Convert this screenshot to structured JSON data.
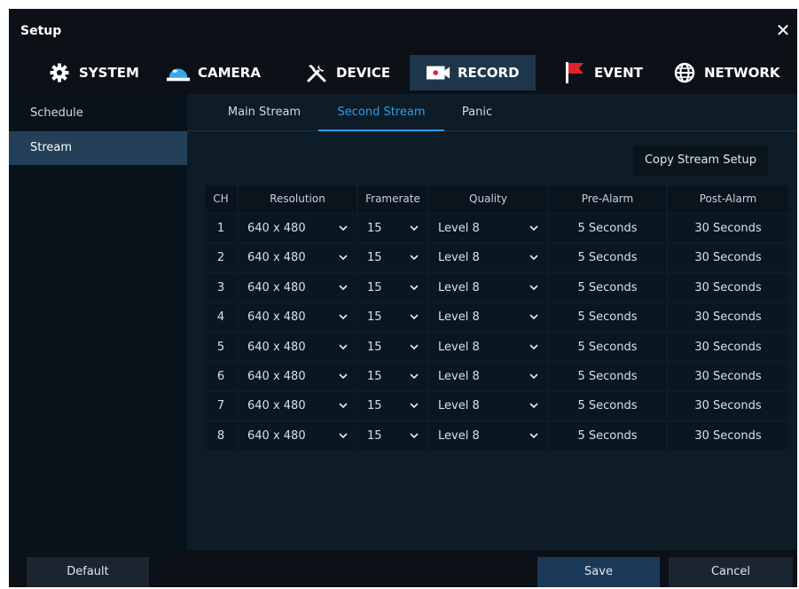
{
  "window": {
    "title": "Setup",
    "close_glyph": "✕"
  },
  "topnav": [
    {
      "label": "SYSTEM",
      "icon": "gear-icon"
    },
    {
      "label": "CAMERA",
      "icon": "dome-camera-icon"
    },
    {
      "label": "DEVICE",
      "icon": "tools-icon"
    },
    {
      "label": "RECORD",
      "icon": "record-icon",
      "active": true
    },
    {
      "label": "EVENT",
      "icon": "flag-icon"
    },
    {
      "label": "NETWORK",
      "icon": "globe-icon"
    }
  ],
  "sidebar": [
    {
      "label": "Schedule"
    },
    {
      "label": "Stream",
      "active": true
    }
  ],
  "subtabs": [
    {
      "label": "Main Stream"
    },
    {
      "label": "Second Stream",
      "active": true
    },
    {
      "label": "Panic"
    }
  ],
  "copy_button": "Copy Stream Setup",
  "table": {
    "headers": [
      "CH",
      "Resolution",
      "Framerate",
      "Quality",
      "Pre-Alarm",
      "Post-Alarm"
    ],
    "rows": [
      {
        "ch": "1",
        "resolution": "640 x 480",
        "framerate": "15",
        "quality": "Level 8",
        "pre": "5 Seconds",
        "post": "30 Seconds"
      },
      {
        "ch": "2",
        "resolution": "640 x 480",
        "framerate": "15",
        "quality": "Level 8",
        "pre": "5 Seconds",
        "post": "30 Seconds"
      },
      {
        "ch": "3",
        "resolution": "640 x 480",
        "framerate": "15",
        "quality": "Level 8",
        "pre": "5 Seconds",
        "post": "30 Seconds"
      },
      {
        "ch": "4",
        "resolution": "640 x 480",
        "framerate": "15",
        "quality": "Level 8",
        "pre": "5 Seconds",
        "post": "30 Seconds"
      },
      {
        "ch": "5",
        "resolution": "640 x 480",
        "framerate": "15",
        "quality": "Level 8",
        "pre": "5 Seconds",
        "post": "30 Seconds"
      },
      {
        "ch": "6",
        "resolution": "640 x 480",
        "framerate": "15",
        "quality": "Level 8",
        "pre": "5 Seconds",
        "post": "30 Seconds"
      },
      {
        "ch": "7",
        "resolution": "640 x 480",
        "framerate": "15",
        "quality": "Level 8",
        "pre": "5 Seconds",
        "post": "30 Seconds"
      },
      {
        "ch": "8",
        "resolution": "640 x 480",
        "framerate": "15",
        "quality": "Level 8",
        "pre": "5 Seconds",
        "post": "30 Seconds"
      }
    ]
  },
  "footer": {
    "default": "Default",
    "save": "Save",
    "cancel": "Cancel"
  },
  "colors": {
    "accent": "#2f9cea",
    "event_flag": "#e0222b",
    "camera_dome": "#3aa7e8"
  }
}
